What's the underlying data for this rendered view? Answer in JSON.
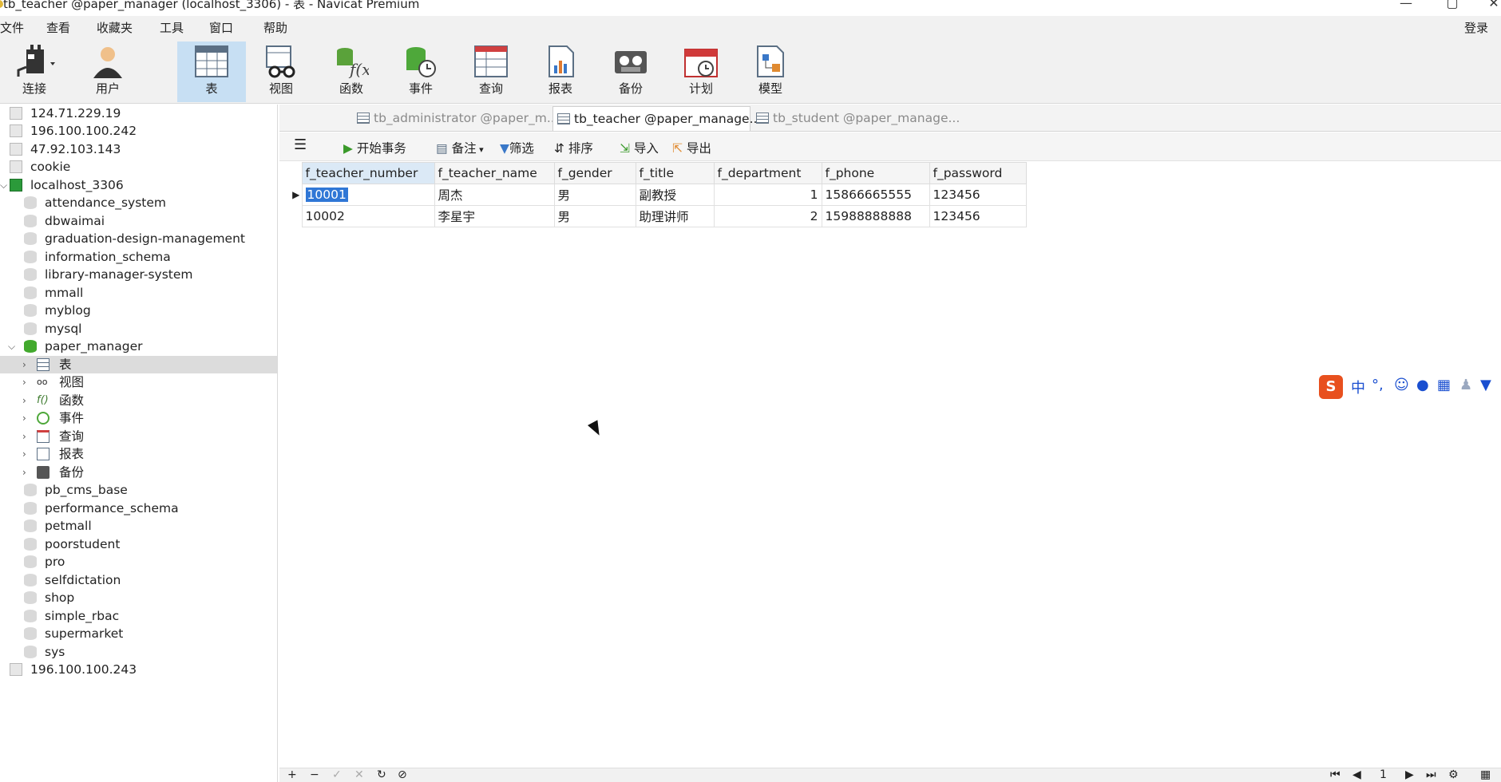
{
  "window": {
    "title": "tb_teacher @paper_manager (localhost_3306) - 表 - Navicat Premium",
    "minimize": "—",
    "restore": "▢",
    "close": "✕"
  },
  "menu": {
    "items": [
      "文件",
      "查看",
      "收藏夹",
      "工具",
      "窗口",
      "帮助"
    ],
    "login": "登录"
  },
  "toolbar": {
    "items": [
      "连接",
      "用户",
      "表",
      "视图",
      "函数",
      "事件",
      "查询",
      "报表",
      "备份",
      "计划",
      "模型"
    ],
    "active": "表"
  },
  "sidebar": {
    "connections_top": [
      "124.71.229.19",
      "196.100.100.242",
      "47.92.103.143",
      "cookie"
    ],
    "open_connection": "localhost_3306",
    "databases_before": [
      "attendance_system",
      "dbwaimai",
      "graduation-design-management",
      "information_schema",
      "library-manager-system",
      "mmall",
      "myblog",
      "mysql"
    ],
    "open_database": "paper_manager",
    "object_groups": [
      "表",
      "视图",
      "函数",
      "事件",
      "查询",
      "报表",
      "备份"
    ],
    "databases_after": [
      "pb_cms_base",
      "performance_schema",
      "petmall",
      "poorstudent",
      "pro",
      "selfdictation",
      "shop",
      "simple_rbac",
      "supermarket",
      "sys"
    ],
    "connections_bottom": [
      "196.100.100.243"
    ]
  },
  "tabs": [
    "tb_administrator @paper_m...",
    "tb_teacher @paper_manage...",
    "tb_student @paper_manage..."
  ],
  "active_tab": "tb_teacher @paper_manage...",
  "table_toolbar": {
    "begin_transaction": "开始事务",
    "comment": "备注",
    "filter": "筛选",
    "sort": "排序",
    "import": "导入",
    "export": "导出"
  },
  "grid": {
    "columns": [
      "f_teacher_number",
      "f_teacher_name",
      "f_gender",
      "f_title",
      "f_department",
      "f_phone",
      "f_password"
    ],
    "rows": [
      [
        "10001",
        "周杰",
        "男",
        "副教授",
        "1",
        "15866665555",
        "123456"
      ],
      [
        "10002",
        "李星宇",
        "男",
        "助理讲师",
        "2",
        "15988888888",
        "123456"
      ]
    ],
    "selected_cell": "10001"
  },
  "bottom": {
    "page": "1"
  },
  "ime": {
    "mode": "中",
    "punct": "°,"
  }
}
